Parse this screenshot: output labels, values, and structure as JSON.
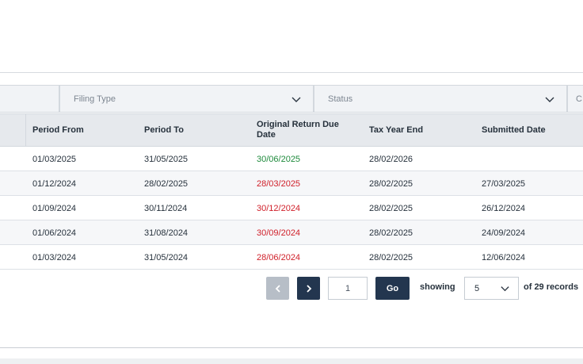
{
  "filters": {
    "filing_type_label": "Filing Type",
    "status_label": "Status",
    "extra_label": "C"
  },
  "table": {
    "columns": [
      "Period From",
      "Period To",
      "Original Return Due Date",
      "Tax Year End",
      "Submitted Date"
    ],
    "rows": [
      {
        "period_from": "01/03/2025",
        "period_to": "31/05/2025",
        "due_date": "30/06/2025",
        "due_status": "ok",
        "tax_year_end": "28/02/2026",
        "submitted": ""
      },
      {
        "period_from": "01/12/2024",
        "period_to": "28/02/2025",
        "due_date": "28/03/2025",
        "due_status": "overdue",
        "tax_year_end": "28/02/2025",
        "submitted": "27/03/2025"
      },
      {
        "period_from": "01/09/2024",
        "period_to": "30/11/2024",
        "due_date": "30/12/2024",
        "due_status": "overdue",
        "tax_year_end": "28/02/2025",
        "submitted": "26/12/2024"
      },
      {
        "period_from": "01/06/2024",
        "period_to": "31/08/2024",
        "due_date": "30/09/2024",
        "due_status": "overdue",
        "tax_year_end": "28/02/2025",
        "submitted": "24/09/2024"
      },
      {
        "period_from": "01/03/2024",
        "period_to": "31/05/2024",
        "due_date": "28/06/2024",
        "due_status": "overdue",
        "tax_year_end": "28/02/2025",
        "submitted": "12/06/2024"
      }
    ]
  },
  "pagination": {
    "page_value": "1",
    "go_label": "Go",
    "showing_label": "showing",
    "page_size": "5",
    "records_label": "of 29 records",
    "prev_icon": "chevron-left-icon",
    "next_icon": "chevron-right-icon"
  },
  "colors": {
    "ok": "#1e8a3c",
    "overdue": "#d0202a",
    "primary_button": "#23364f",
    "disabled_button": "#b7bec7"
  }
}
